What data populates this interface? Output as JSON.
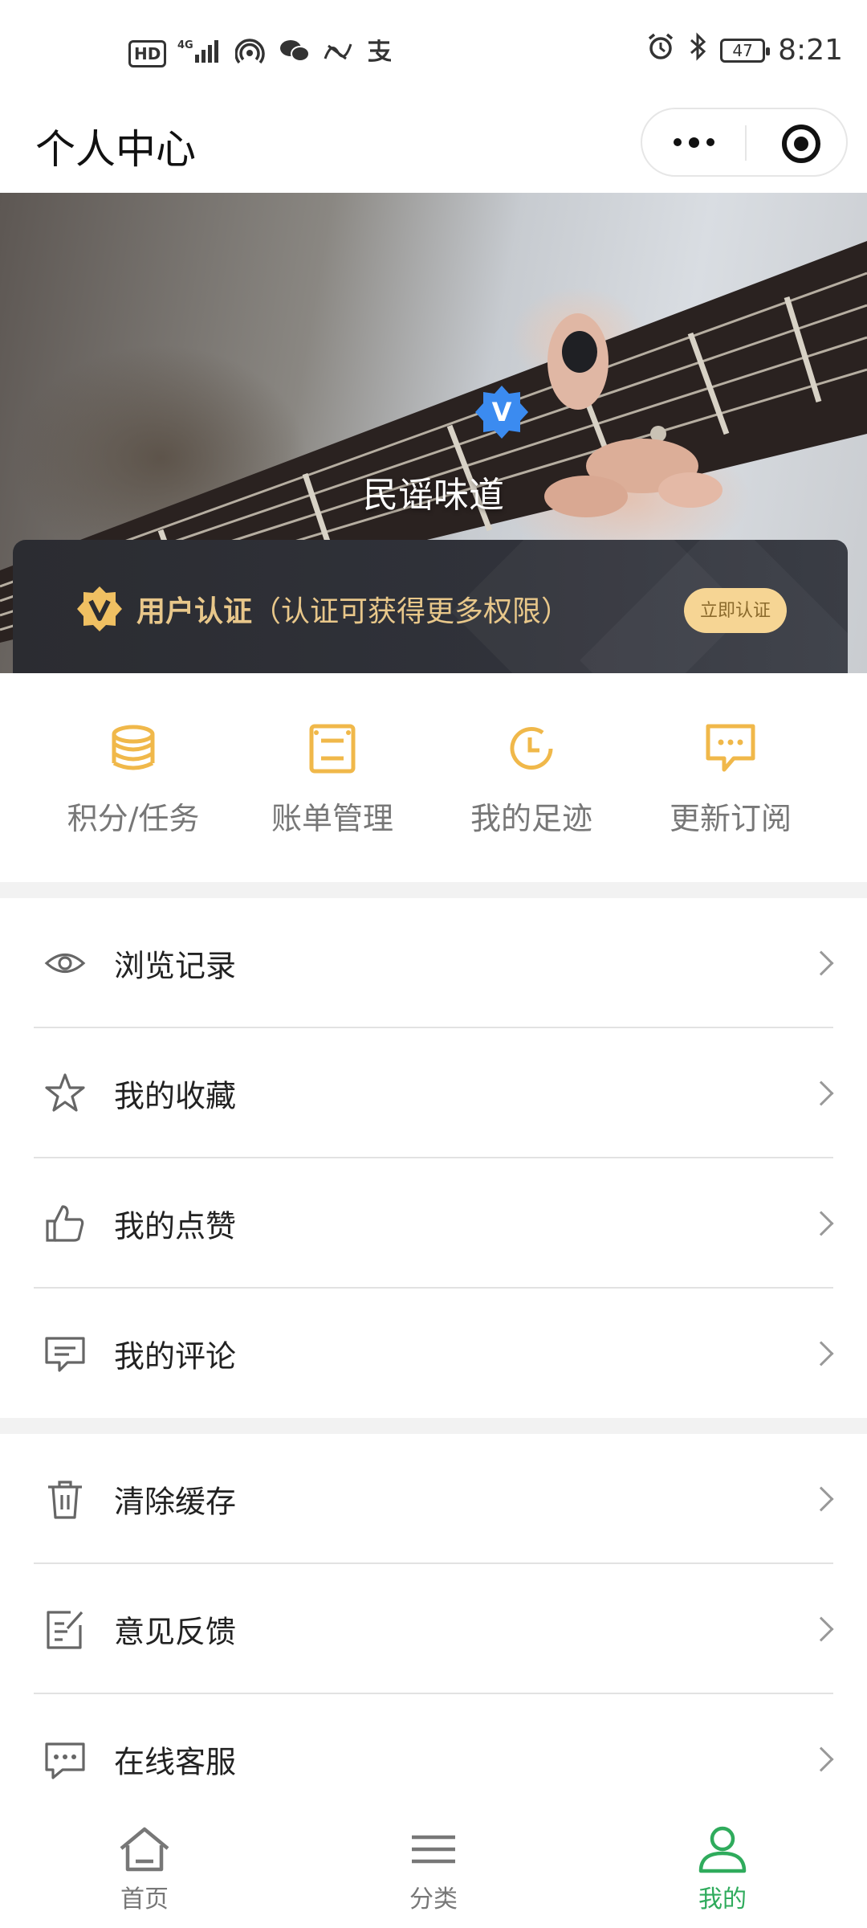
{
  "status_bar": {
    "left_text": "4G",
    "hd": "HD",
    "battery": "47",
    "time": "8:21"
  },
  "title_bar": {
    "title": "个人中心"
  },
  "profile": {
    "username": "民谣味道",
    "badge_letter": "V",
    "auth_title": "用户认证",
    "auth_hint": "（认证可获得更多权限）",
    "auth_button": "立即认证"
  },
  "quick_actions": [
    {
      "label": "积分/任务",
      "icon": "coins-icon"
    },
    {
      "label": "账单管理",
      "icon": "bill-icon"
    },
    {
      "label": "我的足迹",
      "icon": "clock-icon"
    },
    {
      "label": "更新订阅",
      "icon": "message-icon"
    }
  ],
  "menu_group_1": [
    {
      "label": "浏览记录",
      "icon": "eye-icon"
    },
    {
      "label": "我的收藏",
      "icon": "star-icon"
    },
    {
      "label": "我的点赞",
      "icon": "thumbs-up-icon"
    },
    {
      "label": "我的评论",
      "icon": "comment-icon"
    }
  ],
  "menu_group_2": [
    {
      "label": "清除缓存",
      "icon": "trash-icon"
    },
    {
      "label": "意见反馈",
      "icon": "feedback-icon"
    },
    {
      "label": "在线客服",
      "icon": "chat-icon"
    }
  ],
  "tabbar": [
    {
      "label": "首页",
      "icon": "home-icon"
    },
    {
      "label": "分类",
      "icon": "menu-icon"
    },
    {
      "label": "我的",
      "icon": "user-icon",
      "active": true
    }
  ],
  "colors": {
    "accent_yellow": "#f0b84a",
    "tab_active": "#2fab5c",
    "auth_gold": "#e8c78a",
    "verify_blue": "#3b8bf0"
  }
}
